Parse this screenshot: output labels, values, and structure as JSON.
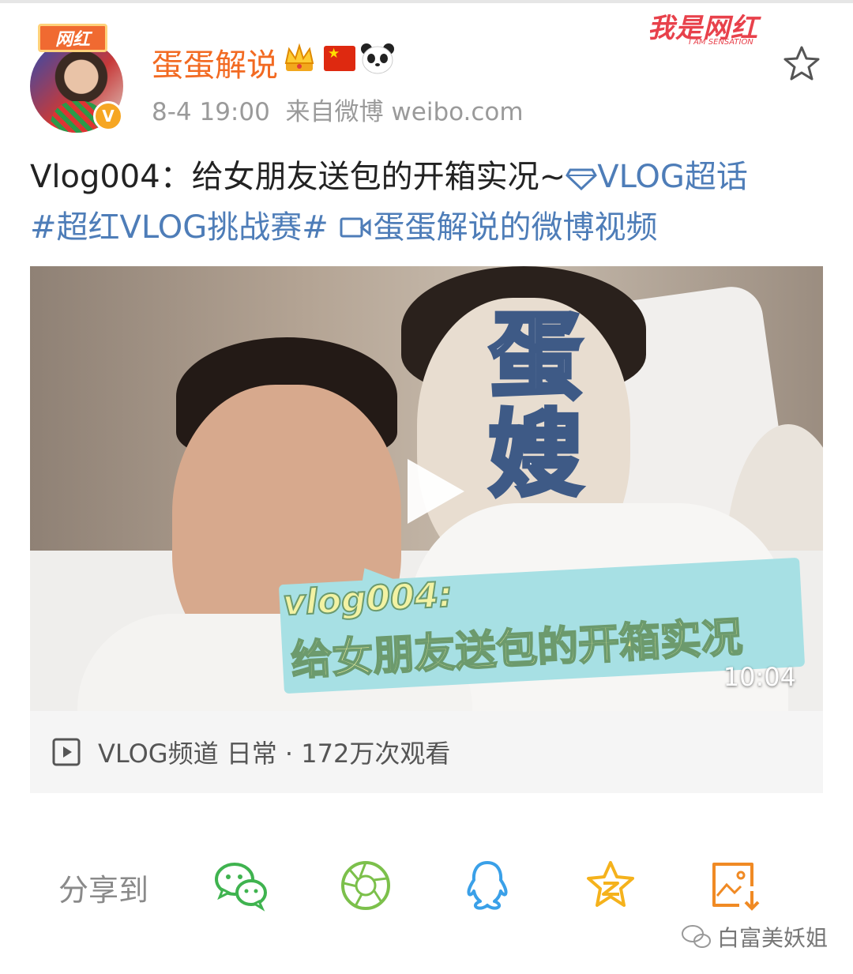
{
  "post": {
    "username": "蛋蛋解说",
    "time": "8-4 19:00",
    "source": "来自微博 weibo.com",
    "badge_text": "网红",
    "verified_letter": "V",
    "text_prefix": "Vlog004：给女朋友送包的开箱实况~",
    "super_topic": "VLOG超话",
    "hashtag": "#超红VLOG挑战赛#",
    "video_link": "蛋蛋解说的微博视频"
  },
  "brand": {
    "title": "我是网红",
    "subtitle": "I AM SENSATION"
  },
  "video": {
    "overlay_big_line1": "蛋",
    "overlay_big_line2": "嫂",
    "caption_line1": "vlog004:",
    "caption_line2": "给女朋友送包的开箱实况",
    "duration": "10:04",
    "info": "VLOG频道 日常 · 172万次观看"
  },
  "share": {
    "label": "分享到",
    "targets": [
      "wechat-icon",
      "moments-icon",
      "qq-icon",
      "qzone-icon",
      "save-image-icon"
    ]
  },
  "watermark": {
    "text": "白富美妖姐"
  },
  "colors": {
    "username": "#f26a22",
    "link": "#4e7db8",
    "wechat": "#3fb34f",
    "moments": "#7cc04b",
    "qq": "#3aa0e8",
    "qzone": "#f5b21c",
    "save": "#f08a24"
  }
}
